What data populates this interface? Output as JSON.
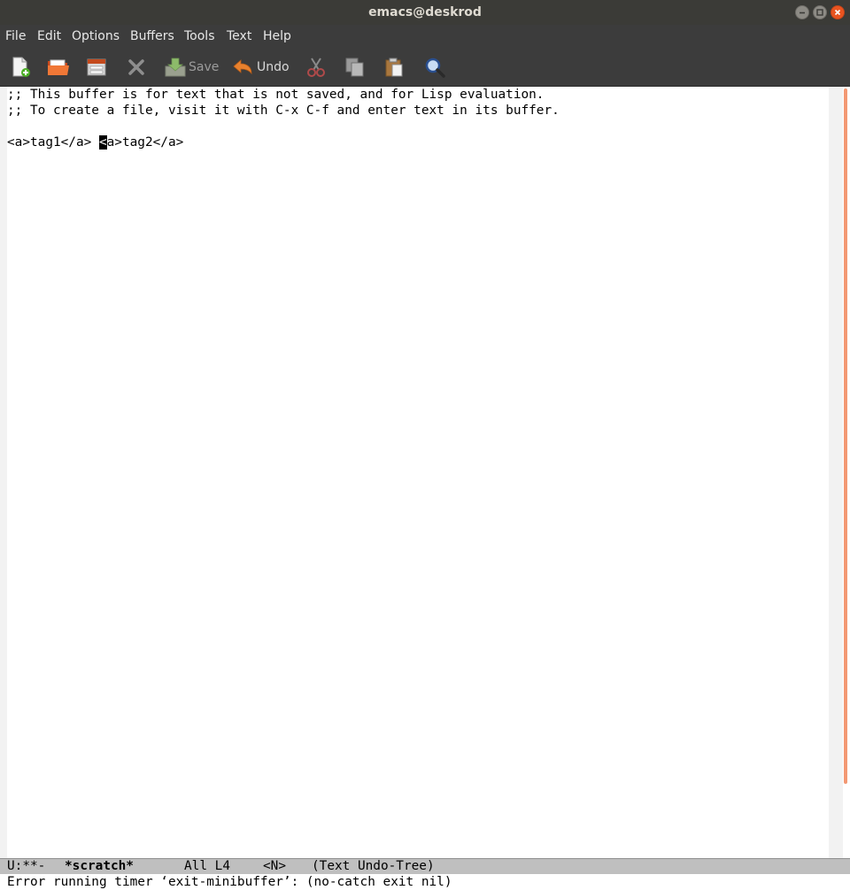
{
  "window": {
    "title": "emacs@deskrod"
  },
  "menu": {
    "items": [
      "File",
      "Edit",
      "Options",
      "Buffers",
      "Tools",
      "Text",
      "Help"
    ]
  },
  "toolbar": {
    "save_label": "Save",
    "undo_label": "Undo",
    "icons": [
      "new-file-icon",
      "open-folder-icon",
      "dired-icon",
      "close-buffer-icon",
      "save-icon",
      "undo-icon",
      "cut-icon",
      "copy-icon",
      "paste-icon",
      "search-icon"
    ]
  },
  "buffer": {
    "lines": [
      ";; This buffer is for text that is not saved, and for Lisp evaluation.",
      ";; To create a file, visit it with C-x C-f and enter text in its buffer.",
      ""
    ],
    "line4": {
      "before_cursor": "<a>tag1</a> ",
      "cursor_char": "<",
      "after_cursor": "a>tag2</a>"
    }
  },
  "modeline": {
    "status": "U:**-",
    "buffer_name": "*scratch*",
    "position": "All L4",
    "narrow": "<N>",
    "modes": "(Text Undo-Tree)"
  },
  "echo_area": {
    "message": "Error running timer ‘exit-minibuffer’: (no-catch exit nil)"
  },
  "colors": {
    "titlebar_bg": "#3b3b37",
    "menubar_bg": "#3c3c3c",
    "close_button": "#e95420",
    "scroll_thumb": "#f39873",
    "modeline_bg": "#bfbfbf"
  }
}
